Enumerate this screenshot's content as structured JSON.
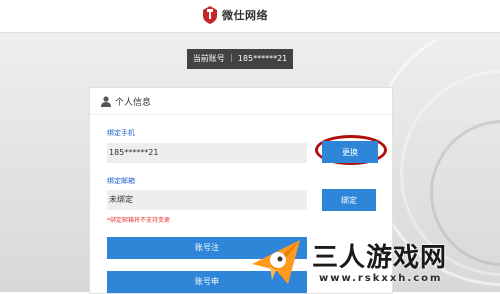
{
  "header": {
    "brand": "微仕网络",
    "logo_icon": "shield-logo-icon"
  },
  "account_bar": {
    "text": "当前账号 ｜ 185******21"
  },
  "panel": {
    "title": "个人信息",
    "user_icon": "user-icon",
    "phone": {
      "label": "绑定手机",
      "value": "185******21",
      "button": "更换"
    },
    "email": {
      "label": "绑定邮箱",
      "value": "未绑定",
      "button": "绑定",
      "hint": "*绑定邮箱将不支持变更"
    },
    "action_buttons": [
      "账号注",
      "账号申"
    ]
  },
  "watermark": {
    "text": "三人游戏网",
    "url": "www.rskxxh.com",
    "icon": "paper-plane-icon"
  },
  "colors": {
    "accent": "#2f86d8",
    "highlight_ring": "#b10e0e",
    "label": "#1d5ec9",
    "hint": "#e53935"
  }
}
